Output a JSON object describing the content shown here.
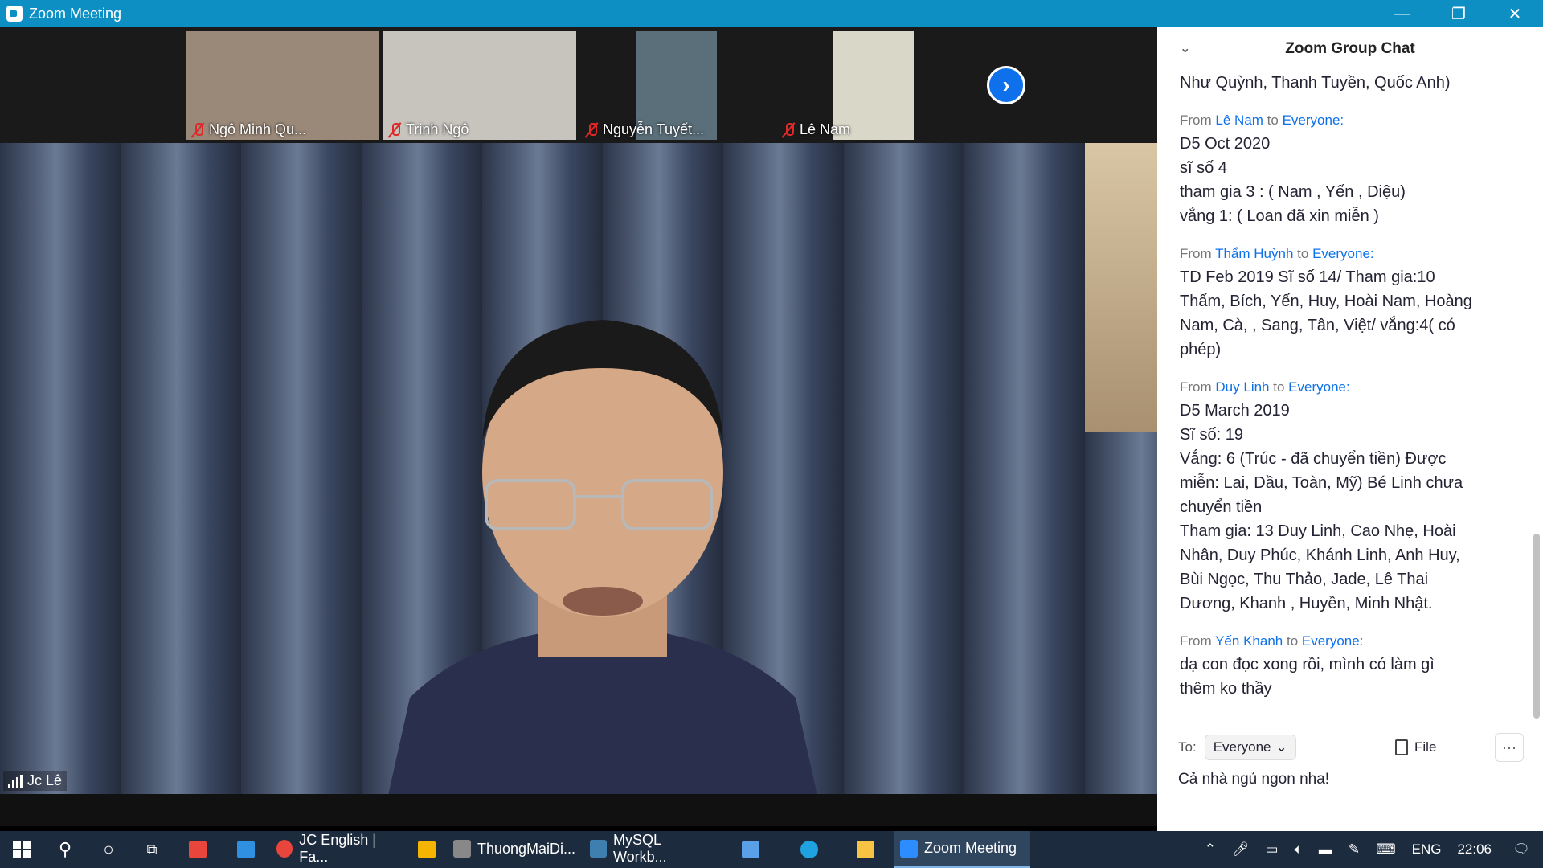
{
  "window": {
    "title": "Zoom Meeting",
    "controls": [
      "—",
      "❐",
      "✕"
    ]
  },
  "thumbnails": [
    {
      "name": "Ngô Minh Qu...",
      "bg": "#9a8878"
    },
    {
      "name": "Trinh Ngô",
      "bg": "#c7c4be"
    },
    {
      "name": "Nguyễn Tuyết...",
      "bg": "#5a6f7a"
    },
    {
      "name": "Lê Nam",
      "bg": "#d9d7c8"
    }
  ],
  "next_page_icon": "chevron-right-icon",
  "active_speaker": {
    "name": "Jc Lê"
  },
  "chat": {
    "title": "Zoom Group Chat",
    "messages": [
      {
        "from": "",
        "to": "",
        "lines": [
          "Như Quỳnh, Thanh Tuyền, Quốc Anh)"
        ]
      },
      {
        "from": "Lê Nam",
        "to": "Everyone:",
        "lines": [
          "D5 Oct 2020",
          "sĩ số 4",
          "tham gia 3 : ( Nam , Yến , Diệu)",
          "vắng 1: ( Loan đã xin miễn )"
        ]
      },
      {
        "from": "Thẩm Huỳnh",
        "to": "Everyone:",
        "lines": [
          "TD Feb 2019 Sĩ số 14/ Tham gia:10",
          "Thẩm, Bích, Yến, Huy, Hoài Nam, Hoàng",
          "Nam, Cà, , Sang, Tân, Việt/ vắng:4( có",
          "phép)"
        ]
      },
      {
        "from": "Duy Linh",
        "to": "Everyone:",
        "lines": [
          "D5 March 2019",
          "Sĩ số: 19",
          "Vắng: 6 (Trúc - đã chuyển tiền) Được",
          "miễn: Lai, Dầu, Toàn, Mỹ) Bé Linh chưa",
          "chuyển tiền",
          "Tham gia: 13 Duy Linh, Cao Nhẹ, Hoài",
          "Nhân, Duy Phúc, Khánh Linh, Anh Huy,",
          "Bùi Ngọc, Thu Thảo, Jade, Lê Thai",
          "Dương, Khanh , Huyền, Minh Nhật."
        ]
      },
      {
        "from": "Yến Khanh",
        "to": "Everyone:",
        "lines": [
          "dạ con đọc xong rồi, mình có làm gì",
          "thêm ko thầy"
        ]
      }
    ],
    "from_label": "From",
    "to_word": "to",
    "to_label": "To:",
    "to_value": "Everyone",
    "file_label": "File",
    "input_value": "Cả nhà ngủ ngon nha!"
  },
  "taskbar": {
    "apps": [
      {
        "label": "JC English | Fa...",
        "icon_color": "#e8453c"
      },
      {
        "label": "",
        "icon_color": "#f4b400"
      },
      {
        "label": "ThuongMaiDi...",
        "icon_color": "#888888"
      },
      {
        "label": "MySQL Workb...",
        "icon_color": "#3e7fb0"
      },
      {
        "label": "",
        "icon_color": "#5aa0e6"
      },
      {
        "label": "",
        "icon_color": "#1fa3e0"
      },
      {
        "label": "",
        "icon_color": "#f6c343"
      },
      {
        "label": "Zoom Meeting",
        "icon_color": "#2d8cff"
      }
    ],
    "lang": "ENG",
    "time": "22:06"
  }
}
